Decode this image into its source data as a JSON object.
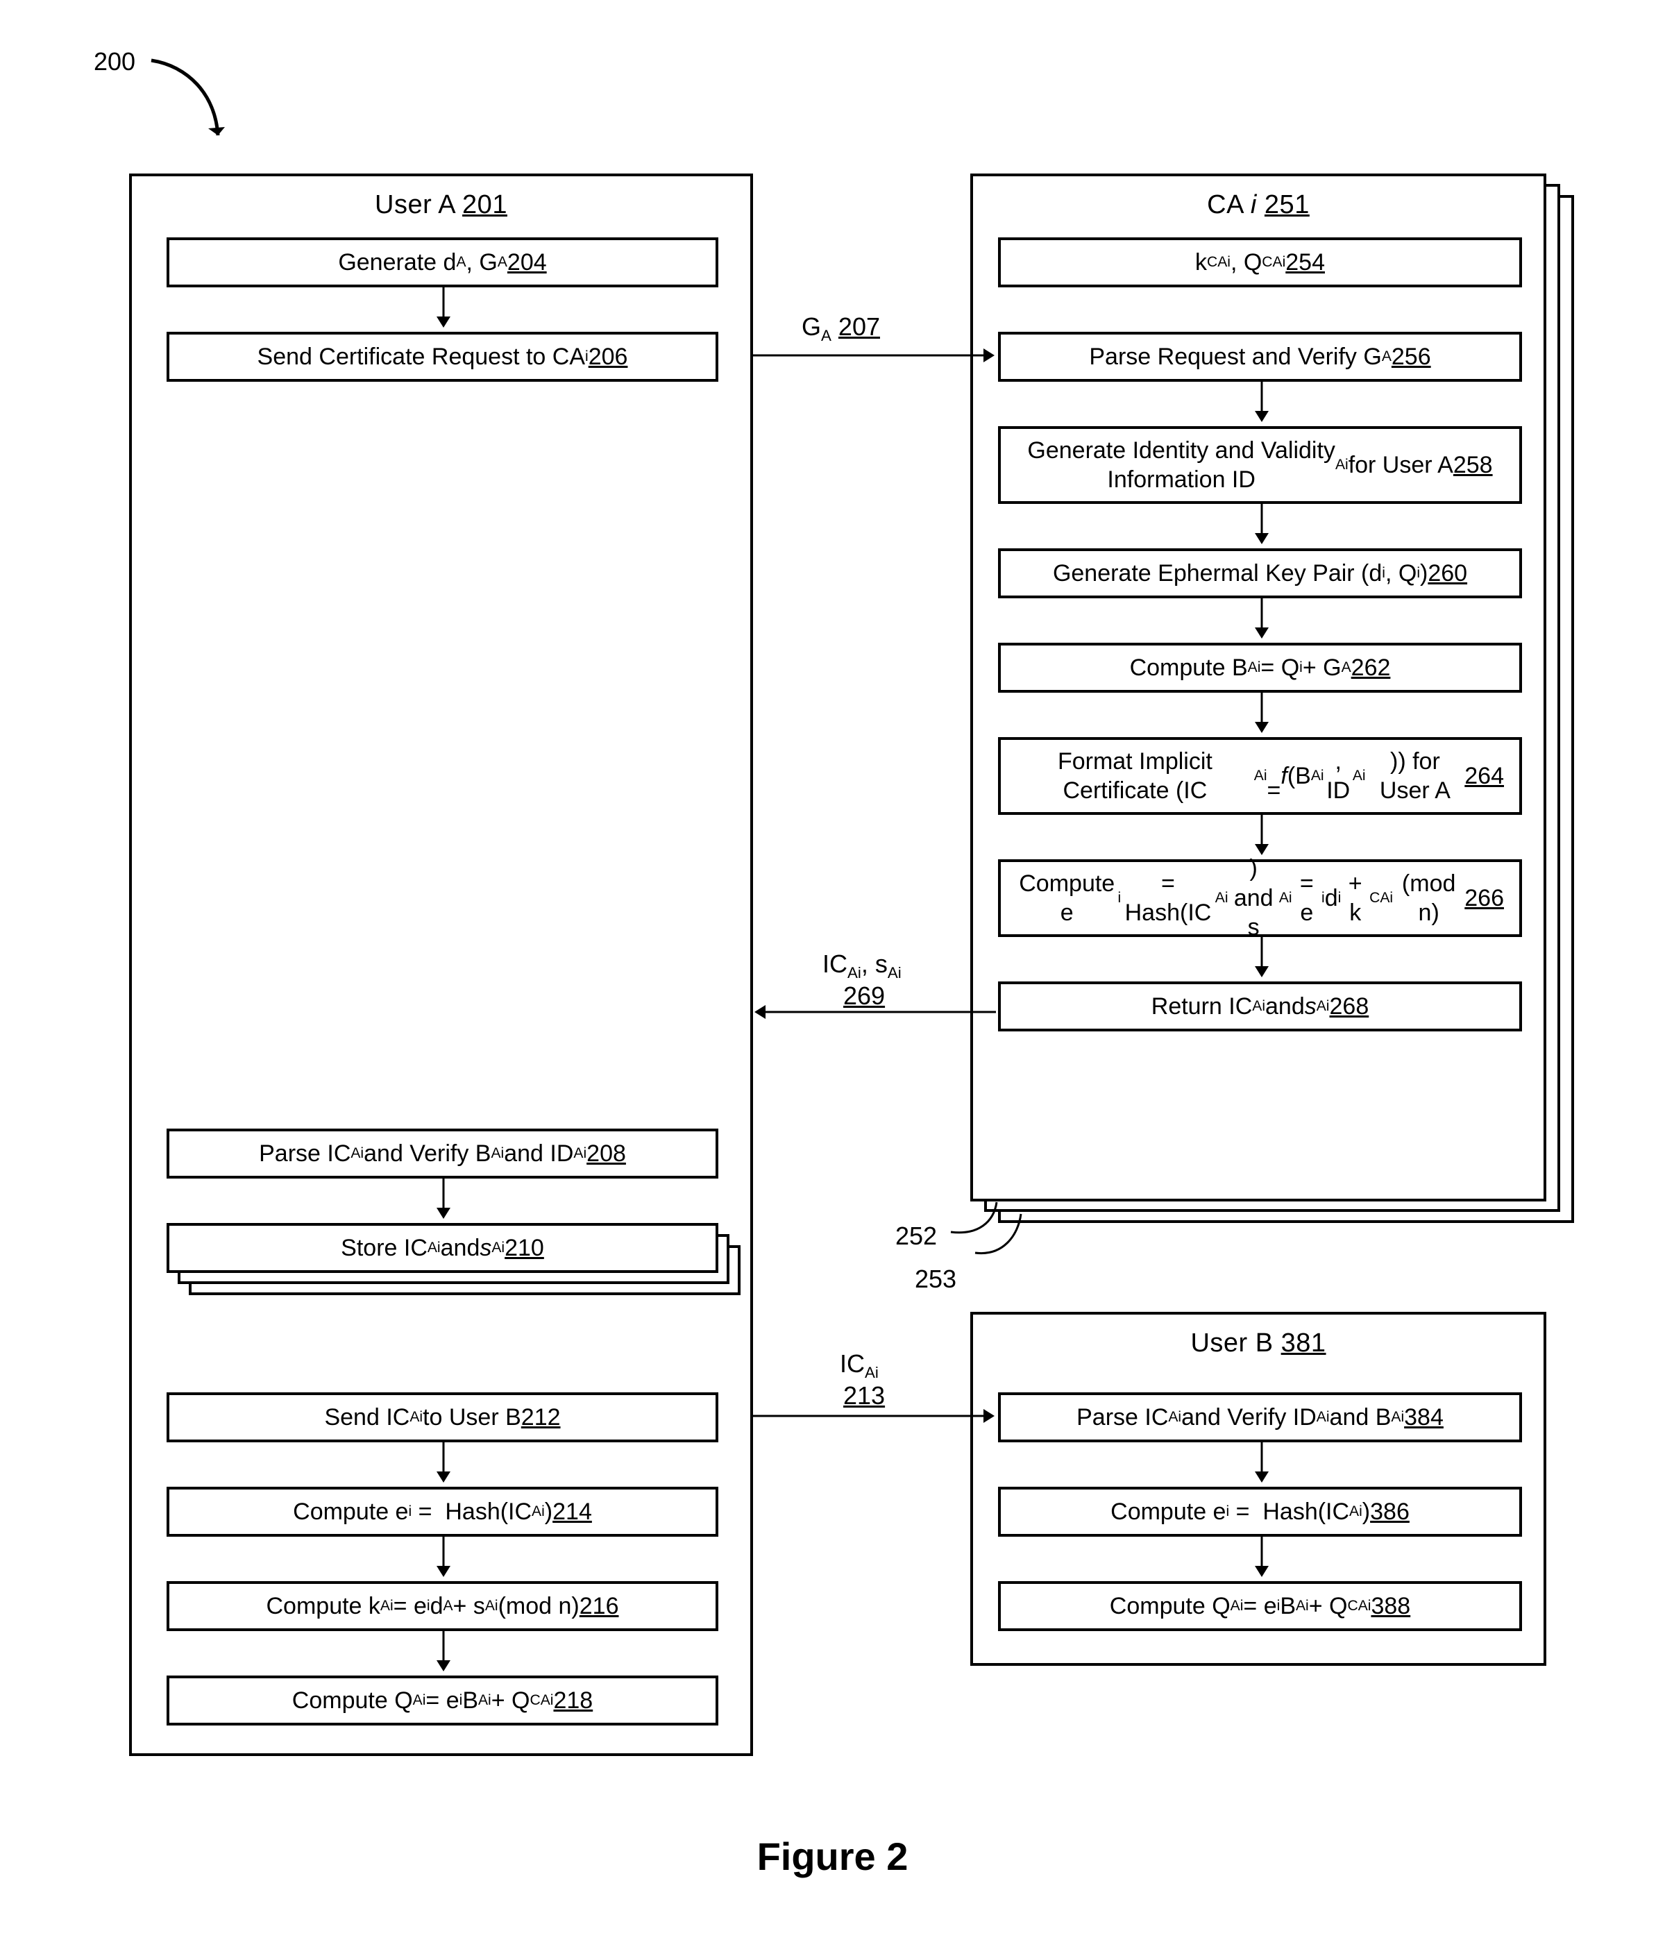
{
  "figure": {
    "number_label": "200",
    "caption": "Figure 2"
  },
  "panels": {
    "userA": {
      "title_html": "User A <span class='ref'>201</span>"
    },
    "ca": {
      "title_html": "CA <span class='ital'>i</span> <span class='ref'>251</span>"
    },
    "userB": {
      "title_html": "User B <span class='ref'>381</span>"
    }
  },
  "userA_steps": {
    "204": "Generate d<span class='sub'>A</span>, G<span class='sub'>A</span> <span class='ref'>204</span>",
    "206": "Send Certificate Request to CA<span class='sub'>i</span> <span class='ref'>206</span>",
    "208": "Parse IC<span class='sub'>Ai</span> and Verify B<span class='sub'>Ai</span> and ID<span class='sub'>Ai</span>  <span class='ref'>208</span>",
    "210": "Store IC<span class='sub'>Ai</span> and <span class='ital'>s</span><span class='sub'>Ai</span> <span class='ref'>210</span>",
    "212": "Send IC<span class='sub'>Ai</span> to User B <span class='ref'>212</span>",
    "214": "Compute e<span class='sub'>i</span> &nbsp;=&nbsp; Hash(IC<span class='sub'>Ai</span>) <span class='ref'>214</span>",
    "216": "Compute k<span class='sub'>Ai</span> = e<span class='sub'>i</span>d<span class='sub'>A</span> + s<span class='sub'>Ai</span> (mod n)  <span class='ref'>216</span>",
    "218": "Compute Q<span class='sub'>Ai</span> = e<span class='sub'>i</span>B<span class='sub'>Ai</span> + Q<span class='sub'>CAi</span> <span class='ref'>218</span>"
  },
  "ca_steps": {
    "254": "k<span class='sub'>CAi</span>, Q<span class='sub'>CAi</span> <span class='ref'>254</span>",
    "256": "Parse Request and Verify G<span class='sub'>A</span> <span class='ref'>256</span>",
    "258": "Generate Identity and Validity<br>Information ID<span class='sub'>Ai</span> for User A <span class='ref'>258</span>",
    "260": "Generate Ephermal Key Pair (d<span class='sub'>i</span>, Q<span class='sub'>i</span>) <span class='ref'>260</span>",
    "262": "Compute B<span class='sub'>Ai</span> = Q<span class='sub'>i</span> + G<span class='sub'>A</span> <span class='ref'>262</span>",
    "264": "Format Implicit Certificate (IC<span class='sub'>Ai</span><br>= <span class='ital'>f</span>(B<span class='sub'>Ai</span>, ID<span class='sub'>Ai</span>)) for User A <span class='ref'>264</span>",
    "266": "Compute e<span class='sub'>i</span> = Hash(IC<span class='sub'>Ai</span>)<br>and s<span class='sub'>Ai</span> = e<span class='sub'>i</span>d<span class='sub'>i</span> + k<span class='sub'>CAi</span> (mod n)  <span class='ref'>266</span>",
    "268": "Return IC<span class='sub'>Ai</span> and <span class='ital'>s</span><span class='sub'>Ai</span> <span class='ref'>268</span>"
  },
  "userB_steps": {
    "384": "Parse IC<span class='sub'>Ai</span> and Verify ID<span class='sub'>Ai</span> and B<span class='sub'>Ai</span> <span class='ref'>384</span>",
    "386": "Compute e<span class='sub'>i</span> &nbsp;=&nbsp; Hash(IC<span class='sub'>Ai</span>) <span class='ref'>386</span>",
    "388": "Compute Q<span class='sub'>Ai</span> = e<span class='sub'>i</span>B<span class='sub'>Ai</span> + Q<span class='sub'>CAi</span> <span class='ref'>388</span>"
  },
  "labels": {
    "207": "G<span class='sub'>A</span> <span class='ref'>207</span>",
    "213_top": "IC<span class='sub'>Ai</span>",
    "213_bot": "<span class='ref'>213</span>",
    "269_top": "IC<span class='sub'>Ai</span>, s<span class='sub'>Ai</span>",
    "269_bot": "<span class='ref'>269</span>",
    "252": "252",
    "253": "253"
  },
  "chart_data": {
    "type": "flowchart",
    "entities": [
      {
        "id": "userA",
        "label": "User A",
        "ref": 201
      },
      {
        "id": "ca_i",
        "label": "CA i",
        "ref": 251,
        "stacked_copies": 2,
        "stack_refs": [
          252,
          253
        ]
      },
      {
        "id": "userB",
        "label": "User B",
        "ref": 381
      }
    ],
    "nodes": [
      {
        "entity": "userA",
        "ref": 204,
        "text": "Generate d_A, G_A"
      },
      {
        "entity": "userA",
        "ref": 206,
        "text": "Send Certificate Request to CA_i"
      },
      {
        "entity": "userA",
        "ref": 208,
        "text": "Parse IC_Ai and Verify B_Ai and ID_Ai"
      },
      {
        "entity": "userA",
        "ref": 210,
        "text": "Store IC_Ai and s_Ai",
        "stacked": true
      },
      {
        "entity": "userA",
        "ref": 212,
        "text": "Send IC_Ai to User B"
      },
      {
        "entity": "userA",
        "ref": 214,
        "text": "Compute e_i = Hash(IC_Ai)"
      },
      {
        "entity": "userA",
        "ref": 216,
        "text": "Compute k_Ai = e_i d_A + s_Ai (mod n)"
      },
      {
        "entity": "userA",
        "ref": 218,
        "text": "Compute Q_Ai = e_i B_Ai + Q_CAi"
      },
      {
        "entity": "ca_i",
        "ref": 254,
        "text": "k_CAi, Q_CAi"
      },
      {
        "entity": "ca_i",
        "ref": 256,
        "text": "Parse Request and Verify G_A"
      },
      {
        "entity": "ca_i",
        "ref": 258,
        "text": "Generate Identity and Validity Information ID_Ai for User A"
      },
      {
        "entity": "ca_i",
        "ref": 260,
        "text": "Generate Ephermal Key Pair (d_i, Q_i)"
      },
      {
        "entity": "ca_i",
        "ref": 262,
        "text": "Compute B_Ai = Q_i + G_A"
      },
      {
        "entity": "ca_i",
        "ref": 264,
        "text": "Format Implicit Certificate (IC_Ai = f(B_Ai, ID_Ai)) for User A"
      },
      {
        "entity": "ca_i",
        "ref": 266,
        "text": "Compute e_i = Hash(IC_Ai) and s_Ai = e_i d_i + k_CAi (mod n)"
      },
      {
        "entity": "ca_i",
        "ref": 268,
        "text": "Return IC_Ai and s_Ai"
      },
      {
        "entity": "userB",
        "ref": 384,
        "text": "Parse IC_Ai and Verify ID_Ai and B_Ai"
      },
      {
        "entity": "userB",
        "ref": 386,
        "text": "Compute e_i = Hash(IC_Ai)"
      },
      {
        "entity": "userB",
        "ref": 388,
        "text": "Compute Q_Ai = e_i B_Ai + Q_CAi"
      }
    ],
    "edges": [
      {
        "from": 204,
        "to": 206
      },
      {
        "from": 206,
        "to": 256,
        "label": "G_A",
        "ref": 207
      },
      {
        "from": 256,
        "to": 258
      },
      {
        "from": 258,
        "to": 260
      },
      {
        "from": 260,
        "to": 262
      },
      {
        "from": 262,
        "to": 264
      },
      {
        "from": 264,
        "to": 266
      },
      {
        "from": 266,
        "to": 268
      },
      {
        "from": 268,
        "to": 208,
        "label": "IC_Ai, s_Ai",
        "ref": 269
      },
      {
        "from": 208,
        "to": 210
      },
      {
        "from": 212,
        "to": 384,
        "label": "IC_Ai",
        "ref": 213
      },
      {
        "from": 212,
        "to": 214
      },
      {
        "from": 214,
        "to": 216
      },
      {
        "from": 216,
        "to": 218
      },
      {
        "from": 384,
        "to": 386
      },
      {
        "from": 386,
        "to": 388
      }
    ]
  }
}
